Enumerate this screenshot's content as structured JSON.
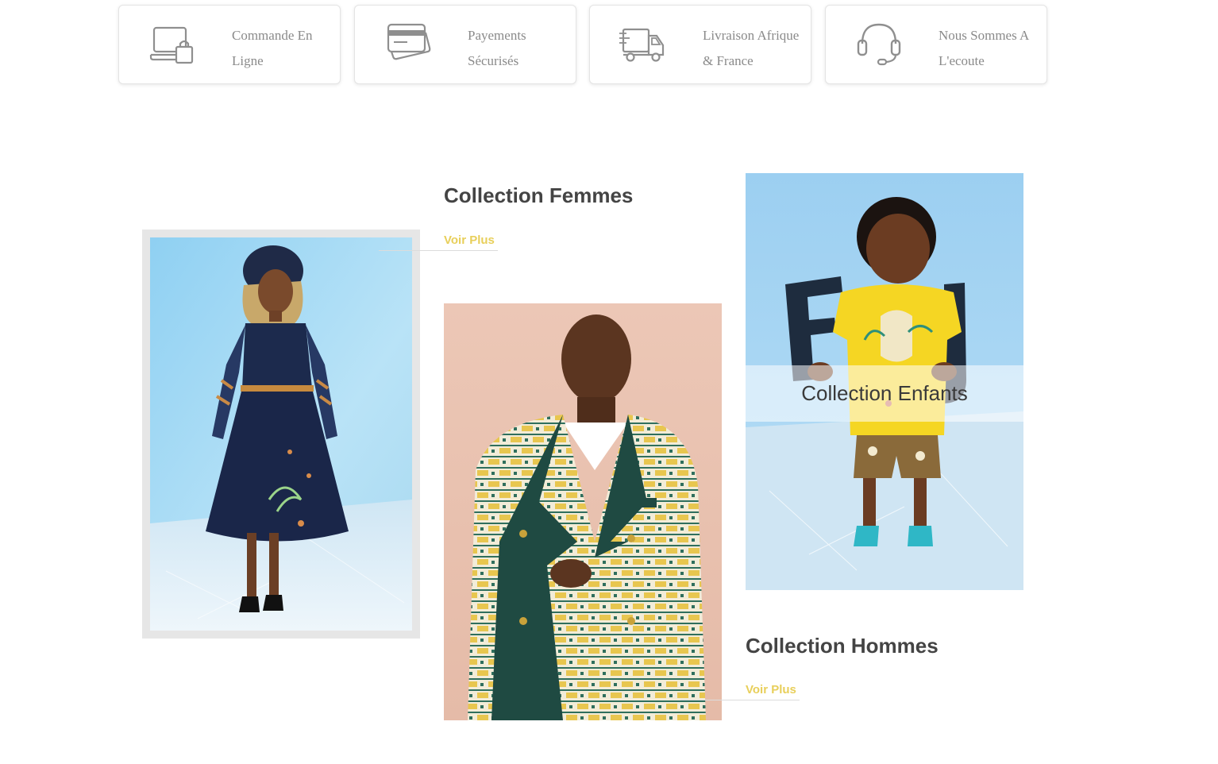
{
  "colors": {
    "accent": "#e8cf5a",
    "icon_grey": "#8f8f8f",
    "text_grey": "#8a8a8a",
    "title": "#444444"
  },
  "features": [
    {
      "icon": "laptop-bag-icon",
      "text": "Commande En Ligne"
    },
    {
      "icon": "credit-card-icon",
      "text": "Payements Sécurisés"
    },
    {
      "icon": "delivery-truck-icon",
      "text": "Livraison Afrique & France"
    },
    {
      "icon": "headset-icon",
      "text": "Nous Sommes A L'ecoute"
    }
  ],
  "collections": {
    "femmes": {
      "title": "Collection Femmes",
      "link": "Voir Plus"
    },
    "enfants": {
      "overlay": "Collection Enfants"
    },
    "hommes": {
      "title": "Collection Hommes",
      "link": "Voir Plus"
    }
  }
}
